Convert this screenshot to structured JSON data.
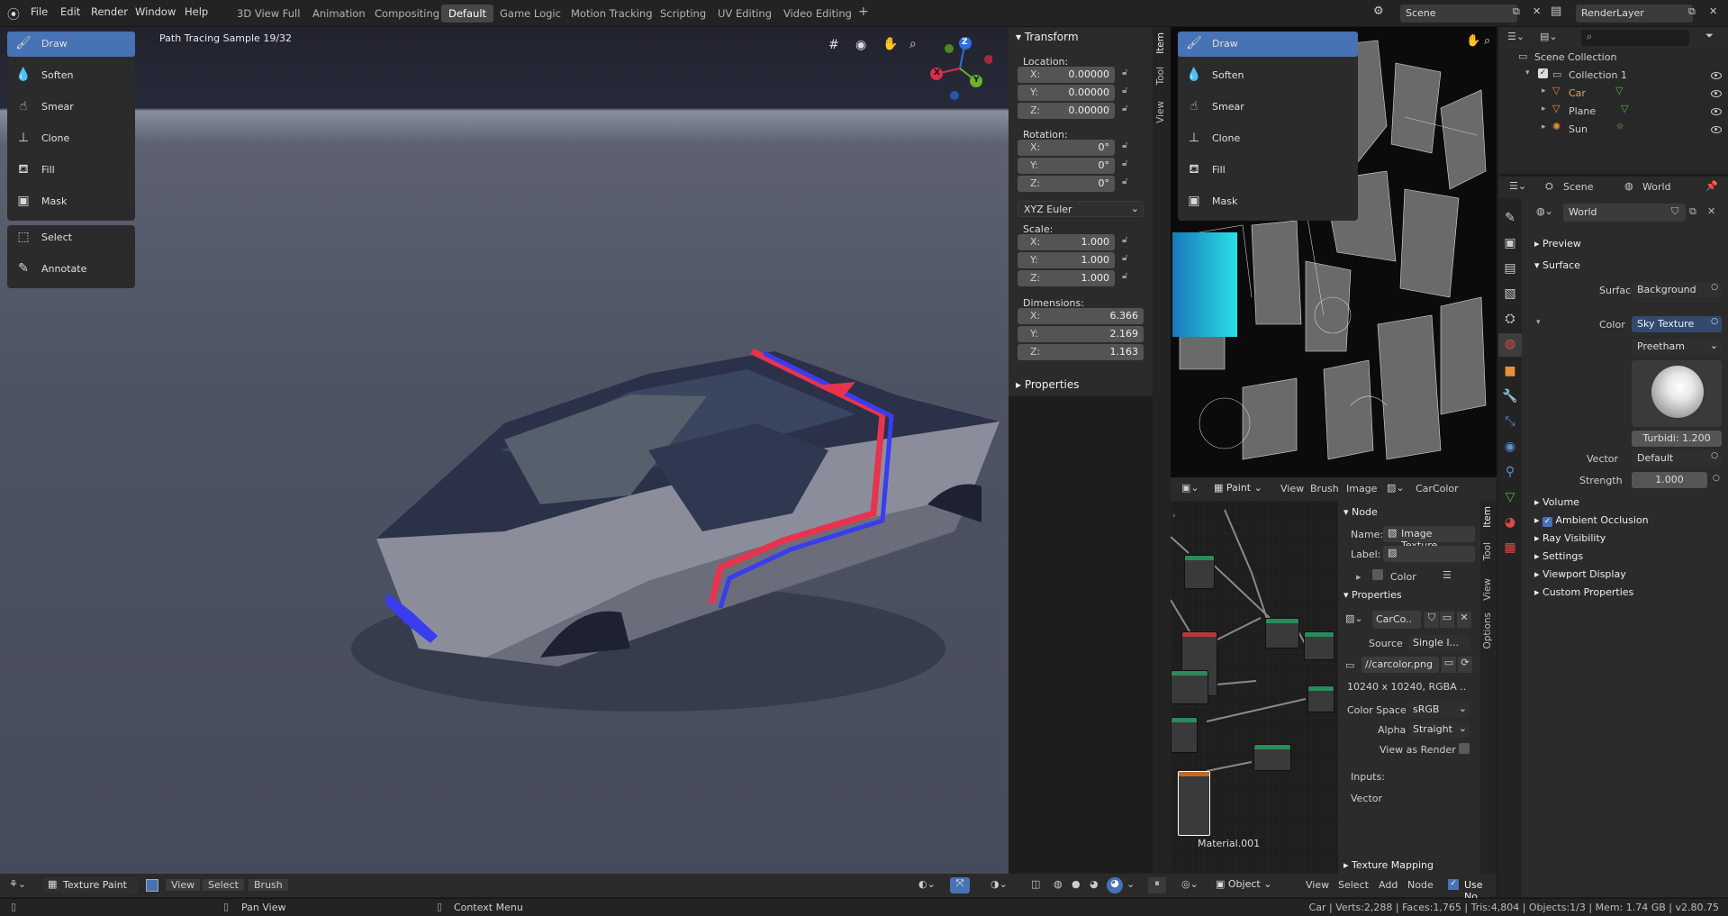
{
  "topbar": {
    "menus": [
      "File",
      "Edit",
      "Render",
      "Window",
      "Help"
    ],
    "workspaces": [
      "3D View Full",
      "Animation",
      "Compositing",
      "Default",
      "Game Logic",
      "Motion Tracking",
      "Scripting",
      "UV Editing",
      "Video Editing"
    ],
    "active_workspace": "Default",
    "add_tab": "+",
    "scene": "Scene",
    "render_layer": "RenderLayer"
  },
  "viewport": {
    "status": "Path Tracing Sample 19/32",
    "gizmo": {
      "x": "X",
      "y": "Y",
      "z": "Z"
    },
    "tools": [
      "Draw",
      "Soften",
      "Smear",
      "Clone",
      "Fill",
      "Mask"
    ],
    "tools2": [
      "Select",
      "Annotate"
    ],
    "footer": {
      "mode": "Texture Paint",
      "view": "View",
      "select": "Select",
      "brush": "Brush"
    }
  },
  "npanel": {
    "transform_title": "Transform",
    "location_label": "Location:",
    "location": [
      {
        "axis": "X:",
        "value": "0.00000"
      },
      {
        "axis": "Y:",
        "value": "0.00000"
      },
      {
        "axis": "Z:",
        "value": "0.00000"
      }
    ],
    "rotation_label": "Rotation:",
    "rotation": [
      {
        "axis": "X:",
        "value": "0°"
      },
      {
        "axis": "Y:",
        "value": "0°"
      },
      {
        "axis": "Z:",
        "value": "0°"
      }
    ],
    "rotation_mode": "XYZ Euler",
    "scale_label": "Scale:",
    "scale": [
      {
        "axis": "X:",
        "value": "1.000"
      },
      {
        "axis": "Y:",
        "value": "1.000"
      },
      {
        "axis": "Z:",
        "value": "1.000"
      }
    ],
    "dimensions_label": "Dimensions:",
    "dimensions": [
      {
        "axis": "X:",
        "value": "6.366"
      },
      {
        "axis": "Y:",
        "value": "2.169"
      },
      {
        "axis": "Z:",
        "value": "1.163"
      }
    ],
    "properties_title": "Properties",
    "tabs": [
      "Item",
      "Tool",
      "View"
    ]
  },
  "image_editor": {
    "tools": [
      "Draw",
      "Soften",
      "Smear",
      "Clone",
      "Fill",
      "Mask"
    ],
    "header": {
      "mode": "Paint",
      "view": "View",
      "brush": "Brush",
      "image": "Image",
      "image_name": "CarColor"
    }
  },
  "node_editor": {
    "material_label": "Material.001",
    "node_panel_title": "Node",
    "name_label": "Name:",
    "name_value": "Image Texture",
    "label_label": "Label:",
    "color_label": "Color",
    "properties_title": "Properties",
    "image_name": "CarCo..",
    "source_label": "Source",
    "source_value": "Single I...",
    "filepath": "//carcolor.png",
    "image_info": "10240 x 10240,  RGBA ..",
    "color_space_label": "Color Space",
    "color_space_value": "sRGB",
    "alpha_label": "Alpha",
    "alpha_value": "Straight",
    "view_as_render": "View as Render",
    "inputs_label": "Inputs:",
    "vector_label": "Vector",
    "texture_mapping": "Texture Mapping",
    "tabs": [
      "Item",
      "Tool",
      "View",
      "Options"
    ],
    "header": {
      "mode": "Object",
      "view": "View",
      "select": "Select",
      "add": "Add",
      "node": "Node",
      "use_nodes": "Use No"
    }
  },
  "outliner": {
    "scene_collection": "Scene Collection",
    "collection": "Collection 1",
    "objects": [
      "Car",
      "Plane",
      "Sun"
    ]
  },
  "properties_editor": {
    "scene_tab": "Scene",
    "world_tab": "World",
    "world_name": "World",
    "preview": "Preview",
    "surface": "Surface",
    "surface_label": "Surface",
    "surface_value": "Background",
    "color_label": "Color",
    "color_value": "Sky Texture",
    "sky_type": "Preetham",
    "turbidity": "Turbidi: 1.200",
    "vector_label": "Vector",
    "vector_value": "Default",
    "strength_label": "Strength",
    "strength_value": "1.000",
    "sections": [
      "Volume",
      "Ambient Occlusion",
      "Ray Visibility",
      "Settings",
      "Viewport Display",
      "Custom Properties"
    ]
  },
  "statusbar": {
    "pan_view": "Pan View",
    "context_menu": "Context Menu",
    "stats": "Car | Verts:2,288 | Faces:1,765 | Tris:4,804 | Objects:1/3 | Mem: 1.74 GB | v2.80.75"
  },
  "colors": {
    "accent": "#4772b3",
    "viewport_bg": "#4b5063",
    "stripe_red": "#e8334f",
    "stripe_blue": "#3a3cf0"
  }
}
